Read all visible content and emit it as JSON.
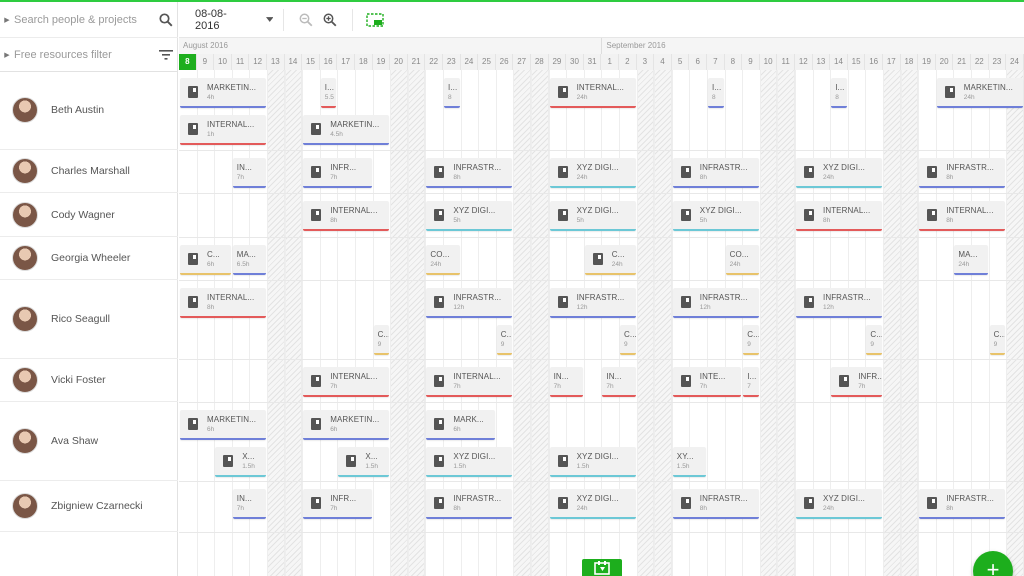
{
  "sidebar": {
    "search_placeholder": "Search people & projects",
    "filter_placeholder": "Free resources filter",
    "people": [
      {
        "name": "Beth Austin"
      },
      {
        "name": "Charles Marshall"
      },
      {
        "name": "Cody Wagner"
      },
      {
        "name": "Georgia Wheeler"
      },
      {
        "name": "Rico Seagull"
      },
      {
        "name": "Vicki Foster"
      },
      {
        "name": "Ava Shaw"
      },
      {
        "name": "Zbigniew Czarnecki"
      }
    ]
  },
  "toolbar": {
    "date_value": "08-08-2016",
    "icons": [
      "chevron-down-icon",
      "zoom-out-icon",
      "zoom-in-icon",
      "select-range-icon"
    ]
  },
  "calendar": {
    "months": [
      "August 2016",
      "September 2016"
    ],
    "today_day": "8",
    "days": [
      "8",
      "9",
      "10",
      "11",
      "12",
      "13",
      "14",
      "15",
      "16",
      "17",
      "18",
      "19",
      "20",
      "21",
      "22",
      "23",
      "24",
      "25",
      "26",
      "27",
      "28",
      "29",
      "30",
      "31",
      "1",
      "2",
      "3",
      "4",
      "5",
      "6",
      "7",
      "8",
      "9",
      "10",
      "11",
      "12",
      "13",
      "14",
      "15",
      "16",
      "17",
      "18",
      "19",
      "20",
      "21",
      "22",
      "23",
      "24"
    ],
    "weekend_days": [
      5,
      6,
      12,
      13,
      19,
      20,
      26,
      27,
      33,
      34,
      40,
      41,
      47
    ]
  },
  "colors": {
    "accent": "#1dae1d",
    "blue": "#6f7fd8",
    "red": "#e35a5a",
    "teal": "#6cc8d6",
    "yellow": "#e8c36a"
  },
  "tasks": [
    {
      "row": 0,
      "sub": 0,
      "start": 0,
      "span": 5,
      "title": "MARKETIN...",
      "hours": "4h",
      "color": "blue"
    },
    {
      "row": 0,
      "sub": 0,
      "start": 8,
      "span": 1,
      "title": "I...",
      "hours": "5.5",
      "color": "red"
    },
    {
      "row": 0,
      "sub": 0,
      "start": 15,
      "span": 1,
      "title": "I...",
      "hours": "8",
      "color": "blue"
    },
    {
      "row": 0,
      "sub": 0,
      "start": 21,
      "span": 5,
      "title": "INTERNAL...",
      "hours": "24h",
      "color": "red"
    },
    {
      "row": 0,
      "sub": 0,
      "start": 30,
      "span": 1,
      "title": "I...",
      "hours": "8",
      "color": "blue"
    },
    {
      "row": 0,
      "sub": 0,
      "start": 37,
      "span": 1,
      "title": "I...",
      "hours": "8",
      "color": "blue"
    },
    {
      "row": 0,
      "sub": 0,
      "start": 43,
      "span": 5,
      "title": "MARKETIN...",
      "hours": "24h",
      "color": "blue"
    },
    {
      "row": 0,
      "sub": 1,
      "start": 0,
      "span": 5,
      "title": "INTERNAL...",
      "hours": "1h",
      "color": "red"
    },
    {
      "row": 0,
      "sub": 1,
      "start": 7,
      "span": 5,
      "title": "MARKETIN...",
      "hours": "4.5h",
      "color": "blue"
    },
    {
      "row": 1,
      "sub": 0,
      "start": 3,
      "span": 2,
      "title": "IN...",
      "hours": "7h",
      "color": "blue"
    },
    {
      "row": 1,
      "sub": 0,
      "start": 7,
      "span": 4,
      "title": "INFR...",
      "hours": "7h",
      "color": "blue"
    },
    {
      "row": 1,
      "sub": 0,
      "start": 14,
      "span": 5,
      "title": "INFRASTR...",
      "hours": "8h",
      "color": "blue"
    },
    {
      "row": 1,
      "sub": 0,
      "start": 21,
      "span": 5,
      "title": "XYZ DIGI...",
      "hours": "24h",
      "color": "teal"
    },
    {
      "row": 1,
      "sub": 0,
      "start": 28,
      "span": 5,
      "title": "INFRASTR...",
      "hours": "8h",
      "color": "blue"
    },
    {
      "row": 1,
      "sub": 0,
      "start": 35,
      "span": 5,
      "title": "XYZ DIGI...",
      "hours": "24h",
      "color": "teal"
    },
    {
      "row": 1,
      "sub": 0,
      "start": 42,
      "span": 5,
      "title": "INFRASTR...",
      "hours": "8h",
      "color": "blue"
    },
    {
      "row": 2,
      "sub": 0,
      "start": 7,
      "span": 5,
      "title": "INTERNAL...",
      "hours": "8h",
      "color": "red"
    },
    {
      "row": 2,
      "sub": 0,
      "start": 14,
      "span": 5,
      "title": "XYZ DIGI...",
      "hours": "5h",
      "color": "teal"
    },
    {
      "row": 2,
      "sub": 0,
      "start": 21,
      "span": 5,
      "title": "XYZ DIGI...",
      "hours": "5h",
      "color": "teal"
    },
    {
      "row": 2,
      "sub": 0,
      "start": 28,
      "span": 5,
      "title": "XYZ DIGI...",
      "hours": "5h",
      "color": "teal"
    },
    {
      "row": 2,
      "sub": 0,
      "start": 35,
      "span": 5,
      "title": "INTERNAL...",
      "hours": "8h",
      "color": "red"
    },
    {
      "row": 2,
      "sub": 0,
      "start": 42,
      "span": 5,
      "title": "INTERNAL...",
      "hours": "8h",
      "color": "red"
    },
    {
      "row": 3,
      "sub": 0,
      "start": 0,
      "span": 3,
      "title": "C...",
      "hours": "6h",
      "color": "yellow"
    },
    {
      "row": 3,
      "sub": 0,
      "start": 3,
      "span": 2,
      "title": "MA...",
      "hours": "6.5h",
      "color": "blue"
    },
    {
      "row": 3,
      "sub": 0,
      "start": 14,
      "span": 2,
      "title": "CO...",
      "hours": "24h",
      "color": "yellow"
    },
    {
      "row": 3,
      "sub": 0,
      "start": 23,
      "span": 3,
      "title": "C...",
      "hours": "24h",
      "color": "yellow"
    },
    {
      "row": 3,
      "sub": 0,
      "start": 31,
      "span": 2,
      "title": "CO...",
      "hours": "24h",
      "color": "yellow"
    },
    {
      "row": 3,
      "sub": 0,
      "start": 44,
      "span": 2,
      "title": "MA...",
      "hours": "24h",
      "color": "blue"
    },
    {
      "row": 4,
      "sub": 0,
      "start": 0,
      "span": 5,
      "title": "INTERNAL...",
      "hours": "8h",
      "color": "red"
    },
    {
      "row": 4,
      "sub": 0,
      "start": 14,
      "span": 5,
      "title": "INFRASTR...",
      "hours": "12h",
      "color": "blue"
    },
    {
      "row": 4,
      "sub": 0,
      "start": 21,
      "span": 5,
      "title": "INFRASTR...",
      "hours": "12h",
      "color": "blue"
    },
    {
      "row": 4,
      "sub": 0,
      "start": 28,
      "span": 5,
      "title": "INFRASTR...",
      "hours": "12h",
      "color": "blue"
    },
    {
      "row": 4,
      "sub": 0,
      "start": 35,
      "span": 5,
      "title": "INFRASTR...",
      "hours": "12h",
      "color": "blue"
    },
    {
      "row": 4,
      "sub": 1,
      "start": 11,
      "span": 1,
      "title": "C...",
      "hours": "9",
      "color": "yellow"
    },
    {
      "row": 4,
      "sub": 1,
      "start": 18,
      "span": 1,
      "title": "C...",
      "hours": "9",
      "color": "yellow"
    },
    {
      "row": 4,
      "sub": 1,
      "start": 25,
      "span": 1,
      "title": "C...",
      "hours": "9",
      "color": "yellow"
    },
    {
      "row": 4,
      "sub": 1,
      "start": 32,
      "span": 1,
      "title": "C...",
      "hours": "9",
      "color": "yellow"
    },
    {
      "row": 4,
      "sub": 1,
      "start": 39,
      "span": 1,
      "title": "C...",
      "hours": "9",
      "color": "yellow"
    },
    {
      "row": 4,
      "sub": 1,
      "start": 46,
      "span": 1,
      "title": "C...",
      "hours": "9",
      "color": "yellow"
    },
    {
      "row": 5,
      "sub": 0,
      "start": 7,
      "span": 5,
      "title": "INTERNAL...",
      "hours": "7h",
      "color": "red"
    },
    {
      "row": 5,
      "sub": 0,
      "start": 14,
      "span": 5,
      "title": "INTERNAL...",
      "hours": "7h",
      "color": "red"
    },
    {
      "row": 5,
      "sub": 0,
      "start": 21,
      "span": 2,
      "title": "IN...",
      "hours": "7h",
      "color": "red"
    },
    {
      "row": 5,
      "sub": 0,
      "start": 24,
      "span": 2,
      "title": "IN...",
      "hours": "7h",
      "color": "red"
    },
    {
      "row": 5,
      "sub": 0,
      "start": 28,
      "span": 4,
      "title": "INTE...",
      "hours": "7h",
      "color": "red"
    },
    {
      "row": 5,
      "sub": 0,
      "start": 32,
      "span": 1,
      "title": "I...",
      "hours": "7",
      "color": "red"
    },
    {
      "row": 5,
      "sub": 0,
      "start": 37,
      "span": 3,
      "title": "INFR...",
      "hours": "7h",
      "color": "red"
    },
    {
      "row": 6,
      "sub": 0,
      "start": 0,
      "span": 5,
      "title": "MARKETIN...",
      "hours": "6h",
      "color": "blue"
    },
    {
      "row": 6,
      "sub": 0,
      "start": 7,
      "span": 5,
      "title": "MARKETIN...",
      "hours": "6h",
      "color": "blue"
    },
    {
      "row": 6,
      "sub": 0,
      "start": 14,
      "span": 4,
      "title": "MARK...",
      "hours": "6h",
      "color": "blue"
    },
    {
      "row": 6,
      "sub": 1,
      "start": 2,
      "span": 3,
      "title": "X...",
      "hours": "1.5h",
      "color": "teal"
    },
    {
      "row": 6,
      "sub": 1,
      "start": 9,
      "span": 3,
      "title": "X...",
      "hours": "1.5h",
      "color": "teal"
    },
    {
      "row": 6,
      "sub": 1,
      "start": 14,
      "span": 5,
      "title": "XYZ DIGI...",
      "hours": "1.5h",
      "color": "teal"
    },
    {
      "row": 6,
      "sub": 1,
      "start": 21,
      "span": 5,
      "title": "XYZ DIGI...",
      "hours": "1.5h",
      "color": "teal"
    },
    {
      "row": 6,
      "sub": 1,
      "start": 28,
      "span": 2,
      "title": "XY...",
      "hours": "1.5h",
      "color": "teal"
    },
    {
      "row": 7,
      "sub": 0,
      "start": 3,
      "span": 2,
      "title": "IN...",
      "hours": "7h",
      "color": "blue"
    },
    {
      "row": 7,
      "sub": 0,
      "start": 7,
      "span": 4,
      "title": "INFR...",
      "hours": "7h",
      "color": "blue"
    },
    {
      "row": 7,
      "sub": 0,
      "start": 14,
      "span": 5,
      "title": "INFRASTR...",
      "hours": "8h",
      "color": "blue"
    },
    {
      "row": 7,
      "sub": 0,
      "start": 21,
      "span": 5,
      "title": "XYZ DIGI...",
      "hours": "24h",
      "color": "teal"
    },
    {
      "row": 7,
      "sub": 0,
      "start": 28,
      "span": 5,
      "title": "INFRASTR...",
      "hours": "8h",
      "color": "blue"
    },
    {
      "row": 7,
      "sub": 0,
      "start": 35,
      "span": 5,
      "title": "XYZ DIGI...",
      "hours": "24h",
      "color": "teal"
    },
    {
      "row": 7,
      "sub": 0,
      "start": 42,
      "span": 5,
      "title": "INFRASTR...",
      "hours": "8h",
      "color": "blue"
    }
  ]
}
